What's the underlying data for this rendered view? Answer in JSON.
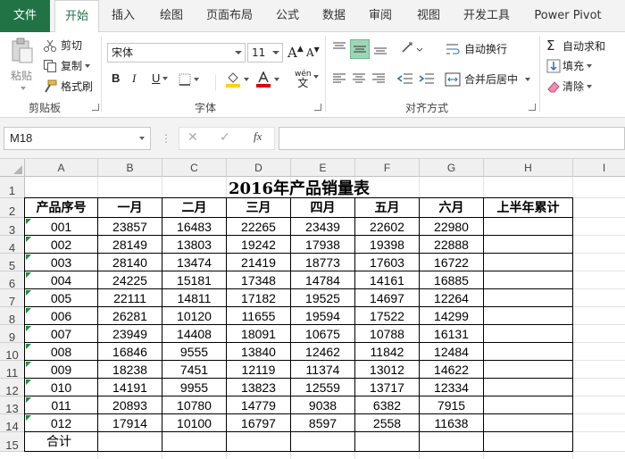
{
  "tabs": [
    "文件",
    "开始",
    "插入",
    "绘图",
    "页面布局",
    "公式",
    "数据",
    "审阅",
    "视图",
    "开发工具",
    "Power Pivot"
  ],
  "ribbon": {
    "clipboard": {
      "paste": "粘贴",
      "cut": "剪切",
      "copy": "复制",
      "format_painter": "格式刷",
      "group": "剪贴板"
    },
    "font": {
      "name": "宋体",
      "size": "11",
      "bold": "B",
      "italic": "I",
      "underline": "U",
      "grow": "A",
      "shrink": "A",
      "phonetic": "wén",
      "group": "字体"
    },
    "alignment": {
      "wrap": "自动换行",
      "merge": "合并后居中",
      "group": "对齐方式"
    },
    "editing": {
      "autosum": "自动求和",
      "fill": "填充",
      "clear": "清除"
    }
  },
  "formula_bar": {
    "name_box": "M18",
    "cancel": "✕",
    "enter": "✓",
    "fx": "fx",
    "value": ""
  },
  "colors": {
    "brand": "#217346",
    "accent_highlight": "#9fd5b7",
    "error_triangle": "#1e8a3a",
    "fill_color": "#ffd400",
    "font_color": "#e00000"
  },
  "sheet": {
    "columns": [
      "A",
      "B",
      "C",
      "D",
      "E",
      "F",
      "G",
      "H",
      "I"
    ],
    "rows": [
      "1",
      "2",
      "3",
      "4",
      "5",
      "6",
      "7",
      "8",
      "9",
      "10",
      "11",
      "12",
      "13",
      "14",
      "15"
    ],
    "title": "2016年产品销量表",
    "headers": [
      "产品序号",
      "一月",
      "二月",
      "三月",
      "四月",
      "五月",
      "六月",
      "上半年累计"
    ],
    "data": [
      [
        "001",
        "23857",
        "16483",
        "22265",
        "23439",
        "22602",
        "22980",
        ""
      ],
      [
        "002",
        "28149",
        "13803",
        "19242",
        "17938",
        "19398",
        "22888",
        ""
      ],
      [
        "003",
        "28140",
        "13474",
        "21419",
        "18773",
        "17603",
        "16722",
        ""
      ],
      [
        "004",
        "24225",
        "15181",
        "17348",
        "14784",
        "14161",
        "16885",
        ""
      ],
      [
        "005",
        "22111",
        "14811",
        "17182",
        "19525",
        "14697",
        "12264",
        ""
      ],
      [
        "006",
        "26281",
        "10120",
        "11655",
        "19594",
        "17522",
        "14299",
        ""
      ],
      [
        "007",
        "23949",
        "14408",
        "18091",
        "10675",
        "10788",
        "16131",
        ""
      ],
      [
        "008",
        "16846",
        "9555",
        "13840",
        "12462",
        "11842",
        "12484",
        ""
      ],
      [
        "009",
        "18238",
        "7451",
        "12119",
        "11374",
        "13012",
        "14622",
        ""
      ],
      [
        "010",
        "14191",
        "9955",
        "13823",
        "12559",
        "13717",
        "12334",
        ""
      ],
      [
        "011",
        "20893",
        "10780",
        "14779",
        "9038",
        "6382",
        "7915",
        ""
      ],
      [
        "012",
        "17914",
        "10100",
        "16797",
        "8597",
        "2558",
        "11638",
        ""
      ]
    ],
    "total_label": "合计"
  }
}
